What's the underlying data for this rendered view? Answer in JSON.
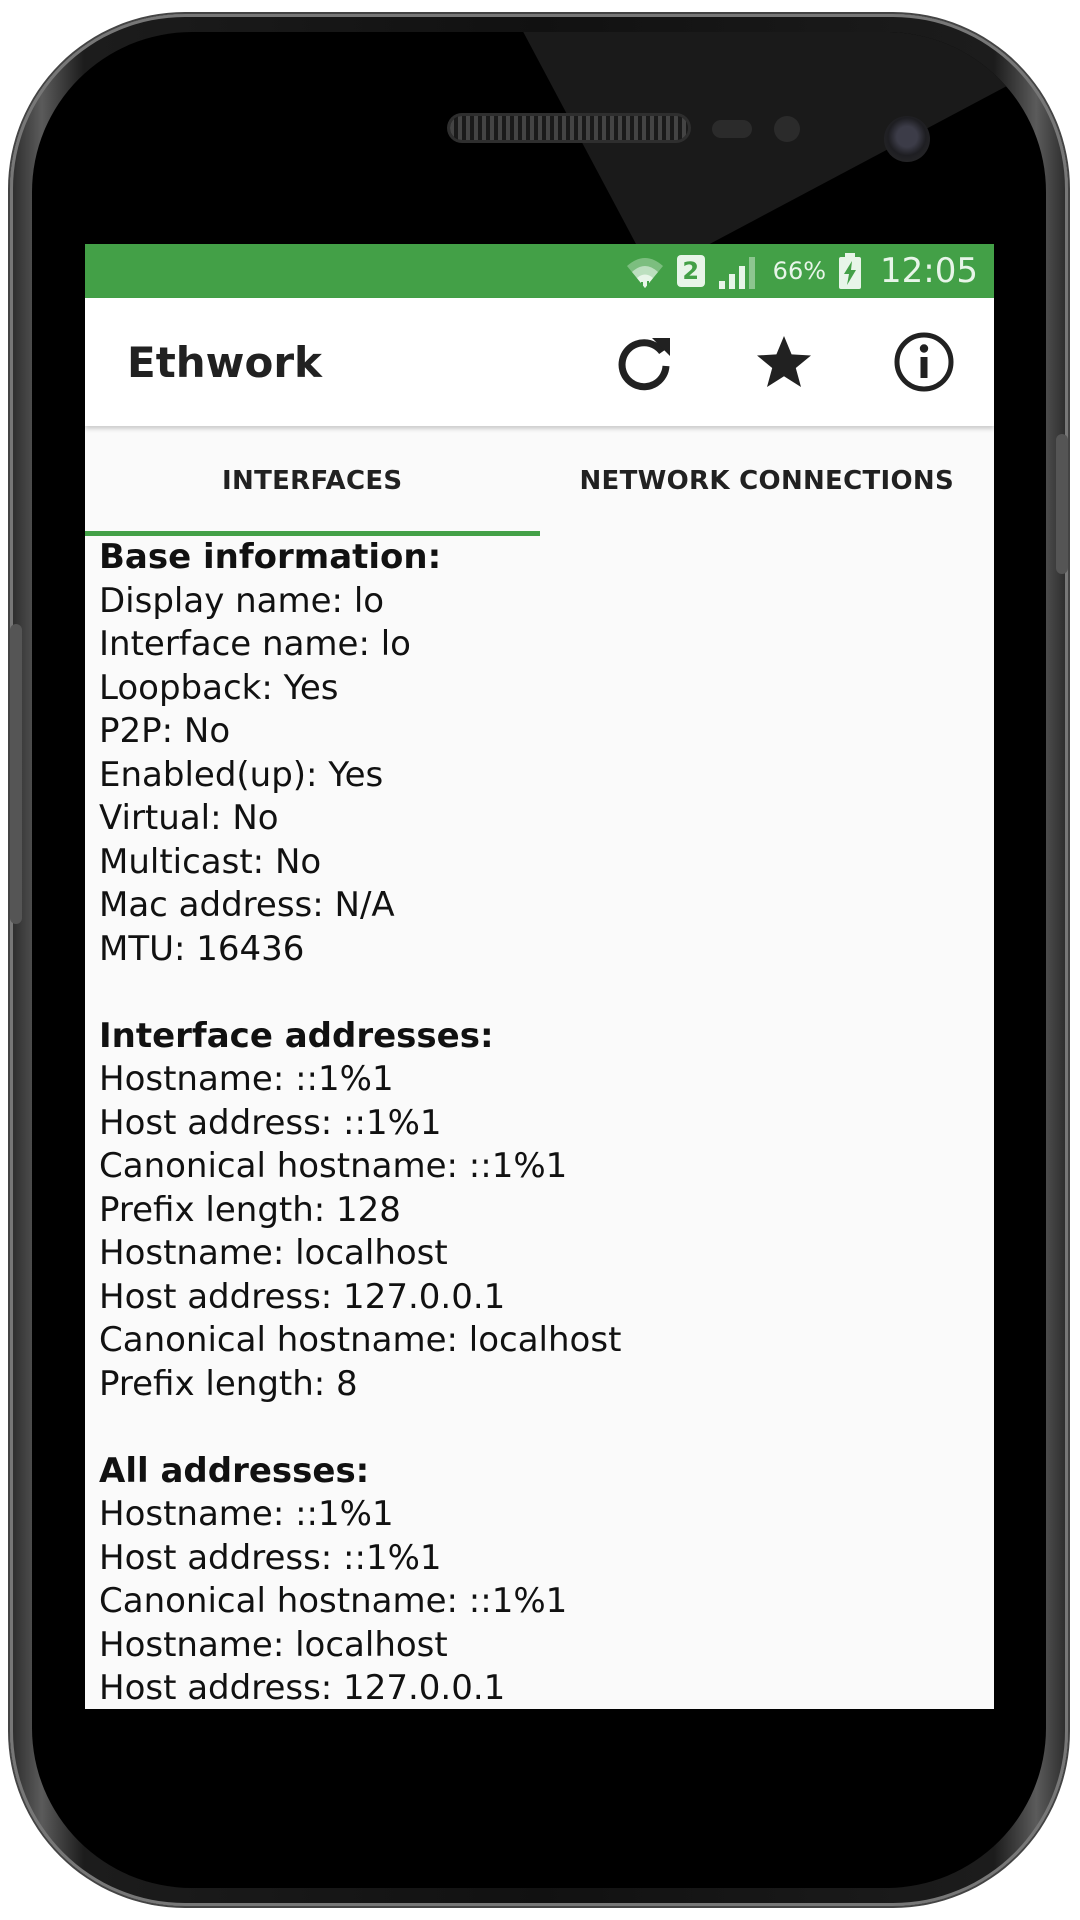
{
  "status_bar": {
    "battery_percent": "66%",
    "time": "12:05",
    "sim_slot": "2",
    "icons": [
      "wifi-icon",
      "sim-icon",
      "signal-icon",
      "battery-charging-icon"
    ],
    "background_color": "#43a047"
  },
  "toolbar": {
    "title": "Ethwork",
    "actions": [
      "refresh-icon",
      "star-icon",
      "info-icon"
    ]
  },
  "tabs": [
    {
      "label": "INTERFACES",
      "active": true
    },
    {
      "label": "NETWORK CONNECTIONS",
      "active": false
    }
  ],
  "accent_color": "#43a047",
  "sections": {
    "base": {
      "title": "Base information:",
      "lines": [
        "Display name: lo",
        "Interface name: lo",
        "Loopback: Yes",
        "P2P: No",
        "Enabled(up): Yes",
        "Virtual: No",
        "Multicast: No",
        "Mac address: N/A",
        "MTU: 16436"
      ]
    },
    "interface_addresses": {
      "title": "Interface addresses:",
      "lines": [
        "Hostname: ::1%1",
        "Host address: ::1%1",
        "Canonical hostname: ::1%1",
        "Prefix length: 128",
        "Hostname: localhost",
        "Host address: 127.0.0.1",
        "Canonical hostname: localhost",
        "Prefix length: 8"
      ]
    },
    "all_addresses": {
      "title": "All addresses:",
      "lines": [
        "Hostname: ::1%1",
        "Host address: ::1%1",
        "Canonical hostname: ::1%1",
        "Hostname: localhost",
        "Host address: 127.0.0.1"
      ]
    }
  }
}
